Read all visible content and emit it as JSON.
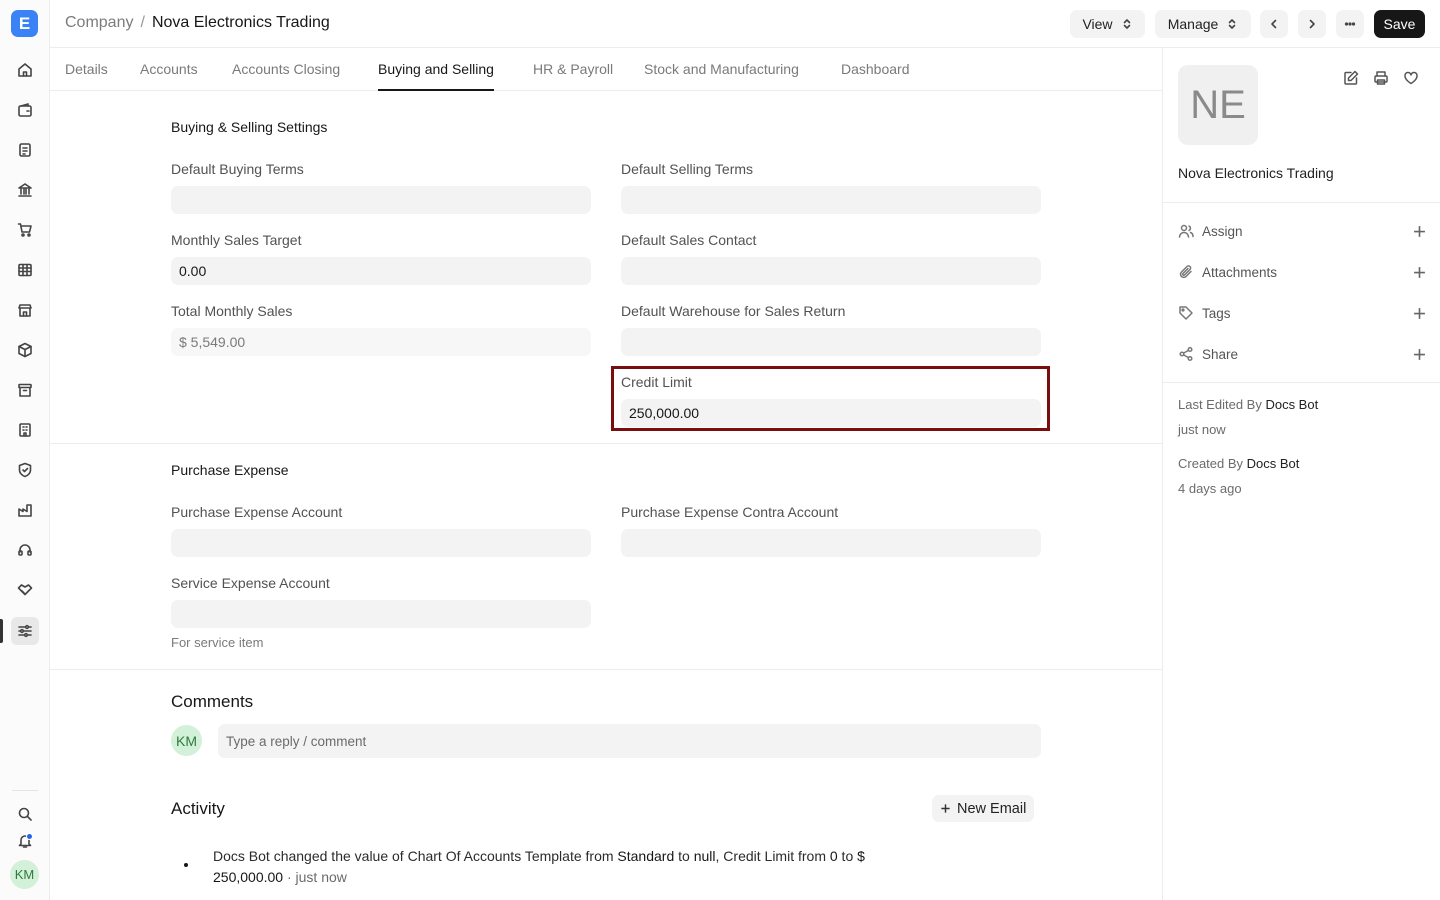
{
  "breadcrumb": {
    "parent": "Company",
    "separator": "/",
    "current": "Nova Electronics Trading"
  },
  "header": {
    "view_label": "View",
    "manage_label": "Manage",
    "save_label": "Save"
  },
  "tabs": [
    {
      "label": "Details"
    },
    {
      "label": "Accounts"
    },
    {
      "label": "Accounts Closing"
    },
    {
      "label": "Buying and Selling",
      "active": true
    },
    {
      "label": "HR & Payroll"
    },
    {
      "label": "Stock and Manufacturing"
    },
    {
      "label": "Dashboard"
    }
  ],
  "buying_selling": {
    "title": "Buying & Selling Settings",
    "default_buying_terms": {
      "label": "Default Buying Terms",
      "value": ""
    },
    "default_selling_terms": {
      "label": "Default Selling Terms",
      "value": ""
    },
    "monthly_sales_target": {
      "label": "Monthly Sales Target",
      "value": "0.00"
    },
    "default_sales_contact": {
      "label": "Default Sales Contact",
      "value": ""
    },
    "total_monthly_sales": {
      "label": "Total Monthly Sales",
      "value": "$ 5,549.00"
    },
    "default_warehouse_sales_return": {
      "label": "Default Warehouse for Sales Return",
      "value": ""
    },
    "credit_limit": {
      "label": "Credit Limit",
      "value": "250,000.00"
    }
  },
  "purchase_expense": {
    "title": "Purchase Expense",
    "purchase_expense_account": {
      "label": "Purchase Expense Account",
      "value": ""
    },
    "purchase_expense_contra_account": {
      "label": "Purchase Expense Contra Account",
      "value": ""
    },
    "service_expense_account": {
      "label": "Service Expense Account",
      "value": "",
      "hint": "For service item"
    }
  },
  "comments": {
    "title": "Comments",
    "avatar": "KM",
    "placeholder": "Type a reply / comment"
  },
  "activity": {
    "title": "Activity",
    "new_email_label": "New Email",
    "entry": {
      "actor": "Docs Bot",
      "t1": " changed the value of Chart Of Accounts Template from ",
      "from1": "Standard",
      "t2": " to ",
      "to1": "null",
      "t3": ", Credit Limit from ",
      "from2": "0",
      "t4": " to ",
      "to2": "$ 250,000.00",
      "time": " · just now"
    }
  },
  "sidebar": {
    "avatar": "NE",
    "name": "Nova Electronics Trading",
    "actions": [
      {
        "label": "Assign",
        "icon": "user-icon"
      },
      {
        "label": "Attachments",
        "icon": "paperclip-icon"
      },
      {
        "label": "Tags",
        "icon": "tag-icon"
      },
      {
        "label": "Share",
        "icon": "share-icon"
      }
    ],
    "last_edited_prefix": "Last Edited By ",
    "last_edited_by": "Docs Bot",
    "last_edited_time": "just now",
    "created_prefix": "Created By ",
    "created_by": "Docs Bot",
    "created_time": "4 days ago"
  },
  "rail": {
    "logo": "E",
    "user_avatar": "KM"
  },
  "colors": {
    "highlight": "#7a0e0e",
    "logo": "#3b82f6",
    "primary_button": "#171717",
    "notification_dot": "#2563eb"
  }
}
